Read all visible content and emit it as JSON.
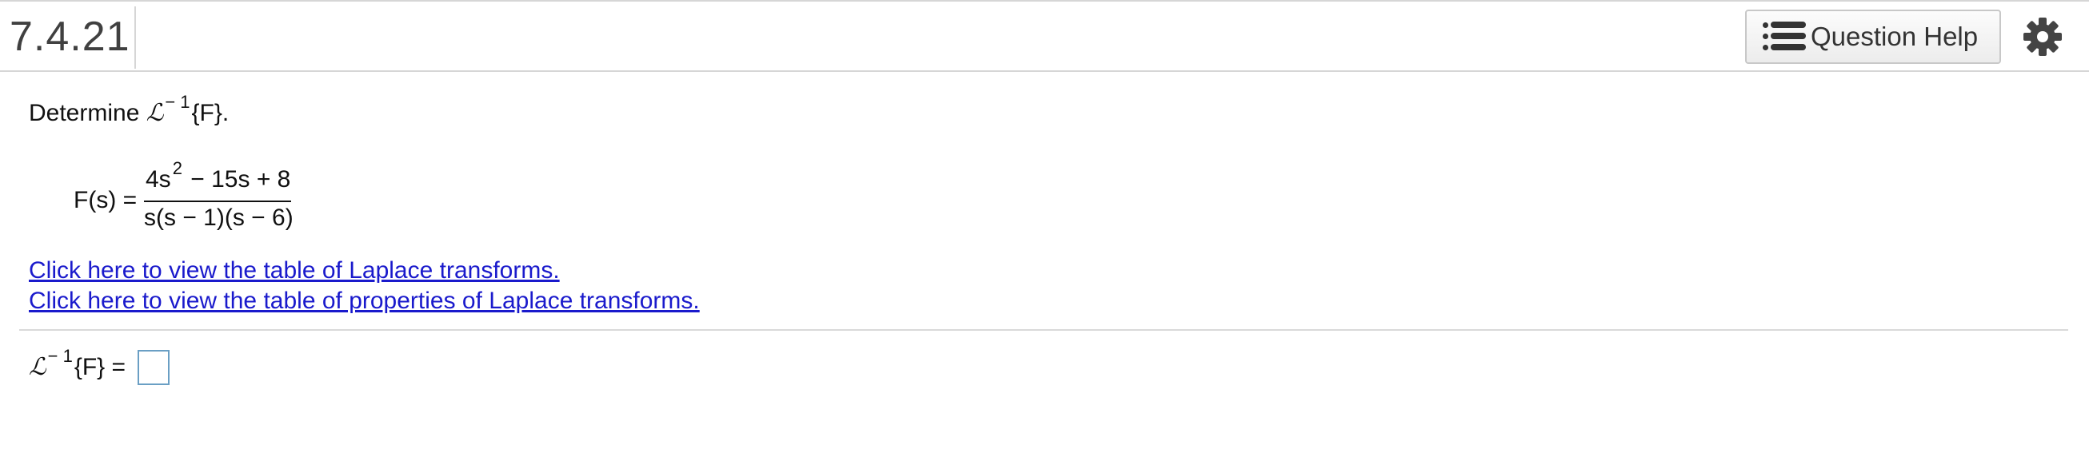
{
  "header": {
    "question_number": "7.4.21",
    "help_button_label": "Question Help",
    "help_icon": "list-icon",
    "settings_icon": "gear-icon"
  },
  "question": {
    "prompt_prefix": "Determine ",
    "operator_symbol": "ℒ",
    "operator_exponent": "− 1",
    "prompt_suffix": "{F}.",
    "function_lhs": "F(s) =",
    "numerator_base": "4s",
    "numerator_exponent": "2",
    "numerator_rest": " − 15s + 8",
    "denominator": "s(s − 1)(s − 6)"
  },
  "links": {
    "laplace_table": "Click here to view the table of Laplace transforms.",
    "properties_table": "Click here to view the table of properties of Laplace transforms."
  },
  "answer": {
    "operator_symbol": "ℒ",
    "operator_exponent": "− 1",
    "expression_suffix": "{F} =",
    "value": ""
  },
  "colors": {
    "link": "#1a1acc",
    "divider": "#d6d6d6",
    "answer_box_border": "#6a9fc4"
  }
}
